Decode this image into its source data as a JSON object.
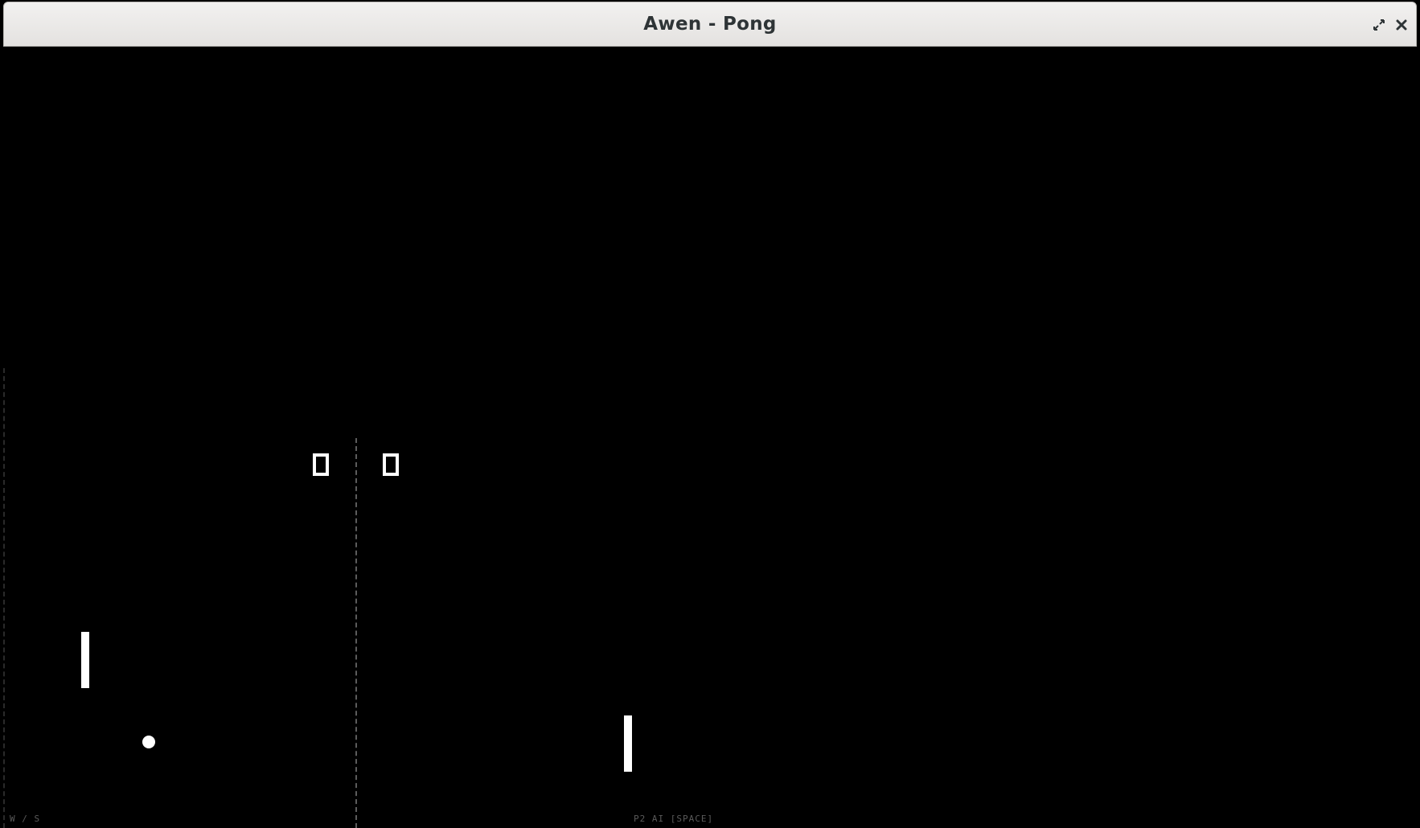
{
  "window": {
    "title": "Awen - Pong",
    "buttons": {
      "restore_icon": "restore-icon",
      "close_icon": "close-icon"
    }
  },
  "game": {
    "score": {
      "player1": "0",
      "player2": "0"
    },
    "controls": {
      "player1_hint": "W / S",
      "player2_hint": "P2 AI [SPACE]"
    }
  },
  "colors": {
    "background": "#000000",
    "foreground": "#ffffff",
    "titlebar": "#ebe9e7"
  }
}
